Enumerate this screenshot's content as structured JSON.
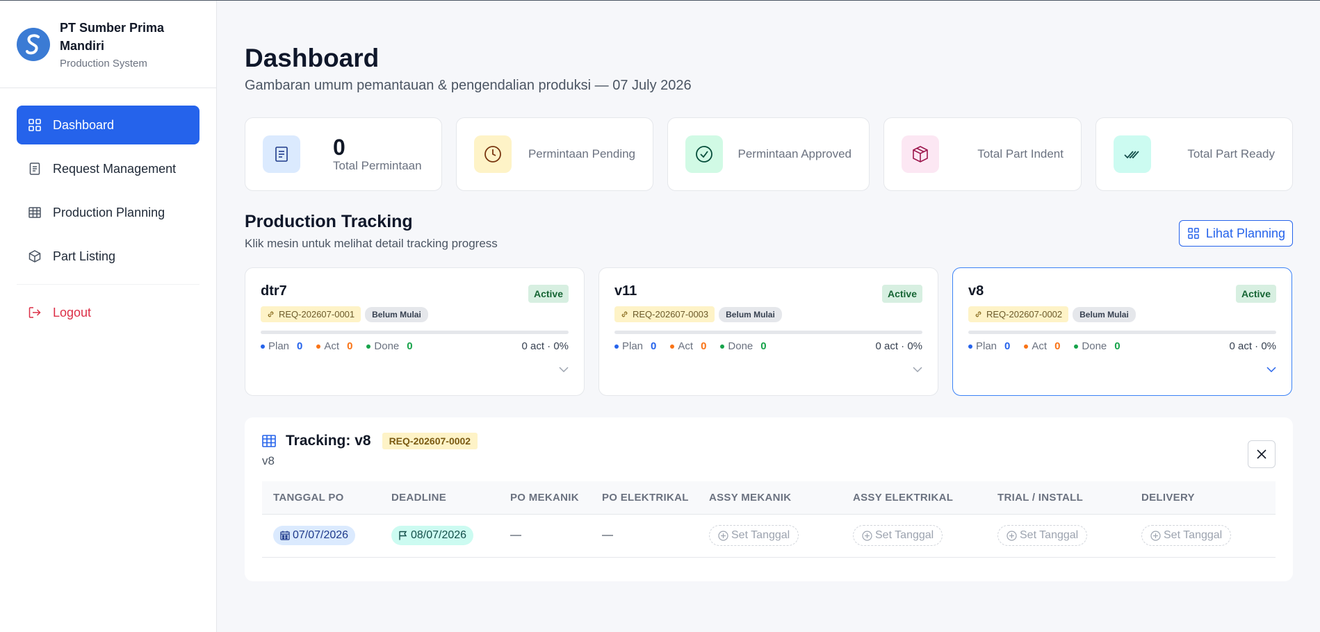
{
  "brand": {
    "name": "PT Sumber Prima Mandiri",
    "subtitle": "Production System"
  },
  "sidebar": {
    "items": [
      {
        "label": "Dashboard",
        "icon": "grid-icon",
        "active": true
      },
      {
        "label": "Request Management",
        "icon": "document-icon"
      },
      {
        "label": "Production Planning",
        "icon": "table-icon"
      },
      {
        "label": "Part Listing",
        "icon": "box-icon"
      }
    ],
    "logout": "Logout"
  },
  "page": {
    "title": "Dashboard",
    "subtitle": "Gambaran umum pemantauan & pengendalian produksi — 07 July 2026"
  },
  "stats": [
    {
      "value": "0",
      "label": "Total Permintaan",
      "icon": "document-icon",
      "color": "#dbeafe"
    },
    {
      "label": "Permintaan Pending",
      "icon": "clock-icon",
      "color": "#fef3c7"
    },
    {
      "label": "Permintaan Approved",
      "icon": "check-circle-icon",
      "color": "#d1fae5"
    },
    {
      "label": "Total Part Indent",
      "icon": "box-icon",
      "color": "#fce7f3"
    },
    {
      "label": "Total Part Ready",
      "icon": "double-check-icon",
      "color": "#ccfbf1"
    }
  ],
  "tracking_section": {
    "title": "Production Tracking",
    "subtitle": "Klik mesin untuk melihat detail tracking progress",
    "planning_button": "Lihat Planning"
  },
  "machines": [
    {
      "name": "dtr7",
      "status": "Active",
      "req": "REQ-202607-0001",
      "progress_status": "Belum Mulai",
      "plan": "0",
      "act": "0",
      "done": "0",
      "summary": "0 act · 0%",
      "progress": 0
    },
    {
      "name": "v11",
      "status": "Active",
      "req": "REQ-202607-0003",
      "progress_status": "Belum Mulai",
      "plan": "0",
      "act": "0",
      "done": "0",
      "summary": "0 act · 0%",
      "progress": 0
    },
    {
      "name": "v8",
      "status": "Active",
      "req": "REQ-202607-0002",
      "progress_status": "Belum Mulai",
      "plan": "0",
      "act": "0",
      "done": "0",
      "summary": "0 act · 0%",
      "progress": 0
    }
  ],
  "legend": {
    "plan": "Plan",
    "act": "Act",
    "done": "Done"
  },
  "detail": {
    "title": "Tracking: v8",
    "req": "REQ-202607-0002",
    "subtitle": "v8",
    "columns": [
      "TANGGAL PO",
      "DEADLINE",
      "PO MEKANIK",
      "PO ELEKTRIKAL",
      "ASSY MEKANIK",
      "ASSY ELEKTRIKAL",
      "TRIAL / INSTALL",
      "DELIVERY"
    ],
    "row": {
      "tanggal_po": "07/07/2026",
      "deadline": "08/07/2026",
      "po_mekanik": "—",
      "po_elektrikal": "—",
      "set_label": "Set Tanggal"
    }
  },
  "colors": {
    "accent": "#2563eb",
    "danger": "#dc2f47",
    "plan": "#2563eb",
    "act": "#f97316",
    "done": "#16a34a"
  }
}
